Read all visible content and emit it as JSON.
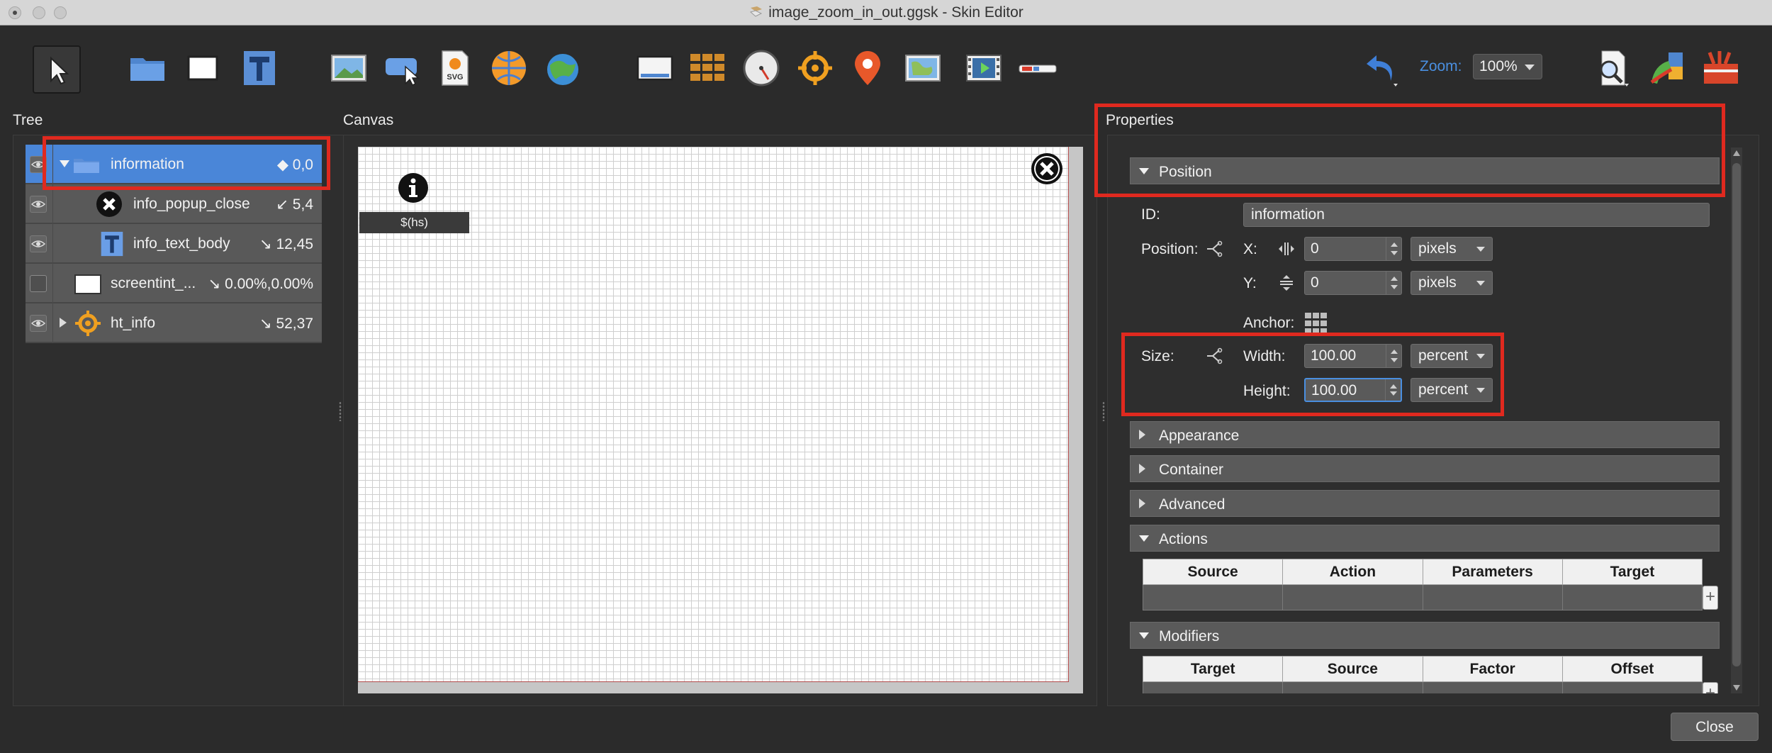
{
  "window": {
    "title": "image_zoom_in_out.ggsk - Skin Editor"
  },
  "toolbar": {
    "tools": [
      "select-tool",
      "container-tool",
      "rectangle-tool",
      "text-tool",
      "image-tool",
      "image-button-tool",
      "svg-tool",
      "hotspot-tool",
      "map-tool",
      "cloner-tool",
      "grid-tool",
      "dial-tool",
      "point-hotspot-tool",
      "map-pin-tool",
      "map-image-tool",
      "video-tool",
      "scrollbar-tool"
    ],
    "zoom_label": "Zoom:",
    "zoom_value": "100%"
  },
  "panels": {
    "tree": "Tree",
    "canvas": "Canvas",
    "properties": "Properties"
  },
  "tree": {
    "rows": [
      {
        "label": "information",
        "coord": "◆ 0,0"
      },
      {
        "label": "info_popup_close",
        "coord": "↙ 5,4"
      },
      {
        "label": "info_text_body",
        "coord": "↘ 12,45"
      },
      {
        "label": "screentint_...",
        "coord": "↘ 0.00%,0.00%"
      },
      {
        "label": "ht_info",
        "coord": "↘ 52,37"
      }
    ]
  },
  "canvas": {
    "hs_text": "$(hs)"
  },
  "properties": {
    "sections": {
      "position": "Position",
      "appearance": "Appearance",
      "container": "Container",
      "advanced": "Advanced",
      "actions": "Actions",
      "modifiers": "Modifiers"
    },
    "id_label": "ID:",
    "id_value": "information",
    "position_label": "Position:",
    "x_label": "X:",
    "x_value": "0",
    "x_unit": "pixels",
    "y_label": "Y:",
    "y_value": "0",
    "y_unit": "pixels",
    "anchor_label": "Anchor:",
    "size_label": "Size:",
    "width_label": "Width:",
    "width_value": "100.00",
    "width_unit": "percent",
    "height_label": "Height:",
    "height_value": "100.00",
    "height_unit": "percent",
    "actions_columns": [
      "Source",
      "Action",
      "Parameters",
      "Target"
    ],
    "modifiers_columns": [
      "Target",
      "Source",
      "Factor",
      "Offset"
    ]
  },
  "footer": {
    "close_label": "Close"
  },
  "colors": {
    "highlight": "#e0291f",
    "selection": "#4a86d8",
    "accent": "#4a8fe0"
  }
}
